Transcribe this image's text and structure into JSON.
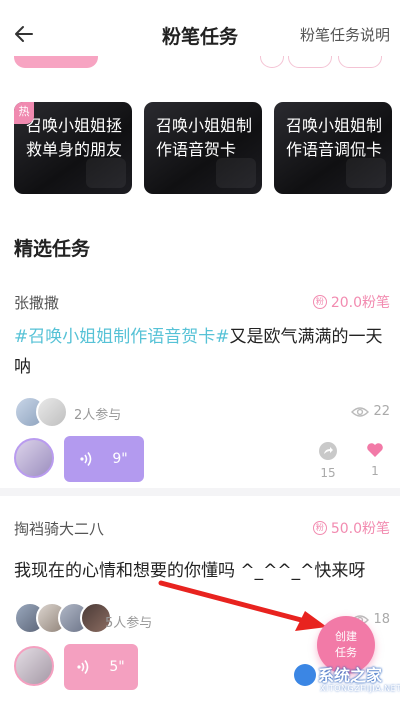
{
  "header": {
    "title": "粉笔任务",
    "help_link": "粉笔任务说明"
  },
  "task_cards": [
    {
      "text": "召唤小姐姐拯救单身的朋友",
      "badge": "热"
    },
    {
      "text": "召唤小姐姐制作语音贺卡",
      "badge": ""
    },
    {
      "text": "召唤小姐姐制作语音调侃卡",
      "badge": ""
    }
  ],
  "section_title": "精选任务",
  "posts": [
    {
      "author": "张撒撒",
      "reward": "20.0粉笔",
      "hashtag": "#召唤小姐姐制作语音贺卡#",
      "text": "又是欧气满满的一天呐",
      "participants": "2人参与",
      "views": "22",
      "voice_duration": "9\"",
      "shares": "15",
      "likes": "1"
    },
    {
      "author": "掏裆骑大二八",
      "reward": "50.0粉笔",
      "text": "我现在的心情和想要的你懂吗 ^_^^_^快来呀",
      "participants": "5人参与",
      "views": "18",
      "voice_duration": "5\""
    }
  ],
  "fab": {
    "line1": "创建",
    "line2": "任务"
  },
  "watermark": {
    "name": "系统之家",
    "sub": "XITONGZHIJIA.NET"
  },
  "colors": {
    "accent_pink": "#f27aa7",
    "hashtag_blue": "#56c2d6",
    "voice_purple": "#b39aef"
  }
}
